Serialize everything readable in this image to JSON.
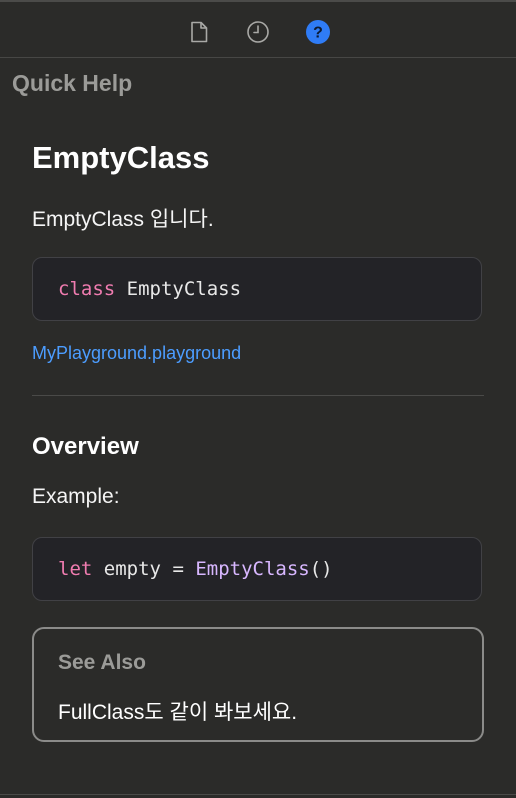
{
  "inspector_tabs": [
    {
      "icon": "file-icon",
      "selected": false
    },
    {
      "icon": "history-clock-icon",
      "selected": false
    },
    {
      "icon": "quick-help-icon",
      "selected": true
    }
  ],
  "colors": {
    "accent": "#2f7cf6",
    "link": "#4c9dff",
    "keyword": "#f07cb0",
    "type": "#d8b7ff"
  },
  "panel_title": "Quick Help",
  "symbol": {
    "name": "EmptyClass",
    "summary": "EmptyClass 입니다.",
    "declaration": {
      "keyword": "class",
      "name": "EmptyClass"
    },
    "file_link": "MyPlayground.playground"
  },
  "overview": {
    "heading": "Overview",
    "text": "Example:",
    "code": {
      "keyword": "let",
      "var": "empty",
      "op": "=",
      "type": "EmptyClass",
      "call": "()"
    }
  },
  "see_also": {
    "title": "See Also",
    "text": "FullClass도 같이 봐보세요."
  }
}
